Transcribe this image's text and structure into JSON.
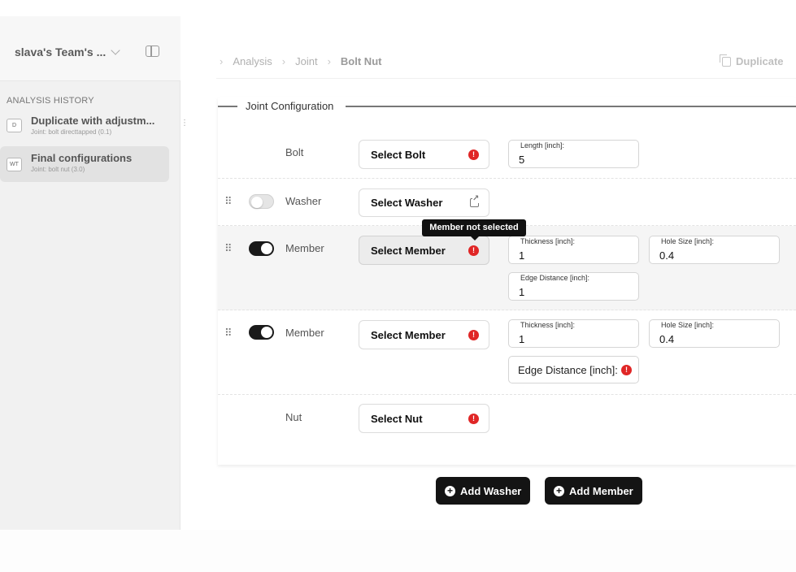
{
  "sidebar": {
    "team_name": "slava's Team's ...",
    "history_title": "ANALYSIS HISTORY",
    "items": [
      {
        "badge": "D",
        "title": "Duplicate with adjustm...",
        "subtitle": "Joint: bolt directtapped (0.1)"
      },
      {
        "badge": "WT",
        "title": "Final configurations",
        "subtitle": "Joint: bolt nut (3.0)"
      }
    ]
  },
  "header": {
    "breadcrumb": [
      "Analysis",
      "Joint",
      "Bolt Nut"
    ],
    "duplicate_label": "Duplicate"
  },
  "config": {
    "legend": "Joint Configuration",
    "tooltip": "Member not selected",
    "rows": [
      {
        "label": "Bolt",
        "select_label": "Select Bolt",
        "fields": [
          {
            "label": "Length [inch]:",
            "value": "5"
          }
        ]
      },
      {
        "label": "Washer",
        "select_label": "Select Washer"
      },
      {
        "label": "Member",
        "select_label": "Select Member",
        "fields": [
          {
            "label": "Thickness [inch]:",
            "value": "1"
          },
          {
            "label": "Hole Size [inch]:",
            "value": "0.4"
          },
          {
            "label": "Edge Distance [inch]:",
            "value": "1"
          }
        ]
      },
      {
        "label": "Member",
        "select_label": "Select Member",
        "fields": [
          {
            "label": "Thickness [inch]:",
            "value": "1"
          },
          {
            "label": "Hole Size [inch]:",
            "value": "0.4"
          },
          {
            "label": "Edge Distance [inch]:"
          }
        ]
      },
      {
        "label": "Nut",
        "select_label": "Select Nut"
      }
    ]
  },
  "actions": {
    "add_washer": "Add Washer",
    "add_member": "Add Member"
  }
}
